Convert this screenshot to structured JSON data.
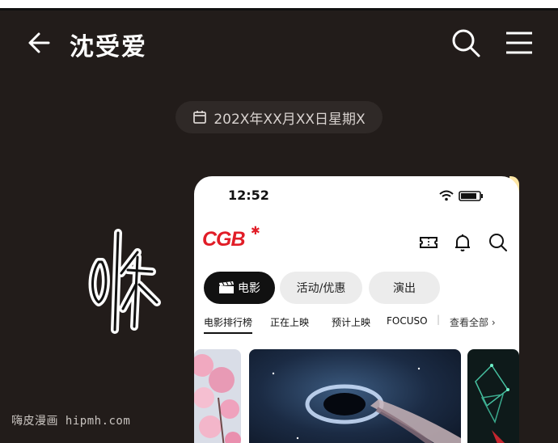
{
  "header": {
    "title": "沈受爱"
  },
  "date_pill": {
    "text": "202X年XX月XX日星期X"
  },
  "phone": {
    "status_time": "12:52",
    "logo": "CGB",
    "tabs": [
      {
        "label": "电影",
        "active": true,
        "icon": "clapperboard-icon"
      },
      {
        "label": "活动/优惠",
        "active": false
      },
      {
        "label": "演出",
        "active": false
      }
    ],
    "subtabs": [
      "电影排行榜",
      "正在上映",
      "预计上映",
      "FOCUSO"
    ],
    "view_all": "查看全部"
  },
  "watermark": "嗨皮漫画 hipmh.com",
  "colors": {
    "background": "#221c1a",
    "brand_red": "#e11d27",
    "pill": "#2f2927"
  }
}
